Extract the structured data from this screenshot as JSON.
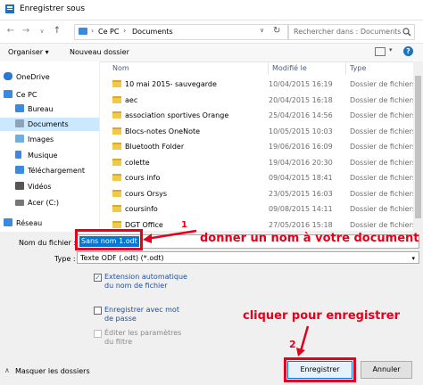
{
  "window": {
    "title": "Enregistrer sous"
  },
  "nav": {
    "breadcrumb": [
      "Ce PC",
      "Documents"
    ],
    "search_placeholder": "Rechercher dans : Documents"
  },
  "toolbar": {
    "organize_label": "Organiser ▾",
    "new_folder_label": "Nouveau dossier"
  },
  "sidebar": {
    "items": [
      {
        "label": "OneDrive",
        "icon": "cloud-icon",
        "color": "#2b78d6"
      },
      {
        "label": "Ce PC",
        "icon": "computer-icon",
        "color": "#3a8be0"
      },
      {
        "label": "Bureau",
        "icon": "desktop-icon",
        "color": "#3a8be0"
      },
      {
        "label": "Documents",
        "icon": "documents-icon",
        "color": "#8fa3b8",
        "selected": true
      },
      {
        "label": "Images",
        "icon": "pictures-icon",
        "color": "#6bb0e8"
      },
      {
        "label": "Musique",
        "icon": "music-icon",
        "color": "#3a8be0"
      },
      {
        "label": "Téléchargement",
        "icon": "download-icon",
        "color": "#3a8be0"
      },
      {
        "label": "Vidéos",
        "icon": "videos-icon",
        "color": "#555"
      },
      {
        "label": "Acer (C:)",
        "icon": "drive-icon",
        "color": "#777"
      },
      {
        "label": "Réseau",
        "icon": "network-icon",
        "color": "#3a8be0"
      }
    ]
  },
  "filelist": {
    "columns": [
      "Nom",
      "Modifié le",
      "Type"
    ],
    "rows": [
      {
        "name": "10 mai 2015- sauvegarde",
        "date": "10/04/2015 16:19",
        "type": "Dossier de fichiers"
      },
      {
        "name": "aec",
        "date": "20/04/2015 16:18",
        "type": "Dossier de fichiers"
      },
      {
        "name": "association sportives Orange",
        "date": "25/04/2016 14:56",
        "type": "Dossier de fichiers"
      },
      {
        "name": "Blocs-notes OneNote",
        "date": "10/05/2015 10:03",
        "type": "Dossier de fichiers"
      },
      {
        "name": "Bluetooth Folder",
        "date": "19/06/2016 16:09",
        "type": "Dossier de fichiers"
      },
      {
        "name": "colette",
        "date": "19/04/2016 20:30",
        "type": "Dossier de fichiers"
      },
      {
        "name": "cours info",
        "date": "09/04/2015 18:41",
        "type": "Dossier de fichiers"
      },
      {
        "name": "cours Orsys",
        "date": "23/05/2015 16:03",
        "type": "Dossier de fichiers"
      },
      {
        "name": "coursinfo",
        "date": "09/08/2015 14:11",
        "type": "Dossier de fichiers"
      },
      {
        "name": "DGT Office",
        "date": "27/05/2016 15:18",
        "type": "Dossier de fichiers"
      }
    ]
  },
  "form": {
    "filename_label": "Nom du fichier :",
    "filename_value": "Sans nom 1.odt",
    "type_label": "Type :",
    "type_value": "Texte ODF (.odt) (*.odt)",
    "options": [
      {
        "label": "Extension automatique du nom de fichier",
        "checked": true,
        "disabled": false
      },
      {
        "label": "Enregistrer avec mot de passe",
        "checked": false,
        "disabled": false
      },
      {
        "label": "Éditer les paramètres du filtre",
        "checked": false,
        "disabled": true
      }
    ],
    "hide_folders_label": "Masquer les dossiers",
    "save_label": "Enregistrer",
    "cancel_label": "Annuler"
  },
  "annotations": {
    "step1_number": "1",
    "step1_text": "donner un nom à votre document",
    "step2_number": "2",
    "step2_text": "cliquer pour enregistrer",
    "color": "#e5001b"
  }
}
